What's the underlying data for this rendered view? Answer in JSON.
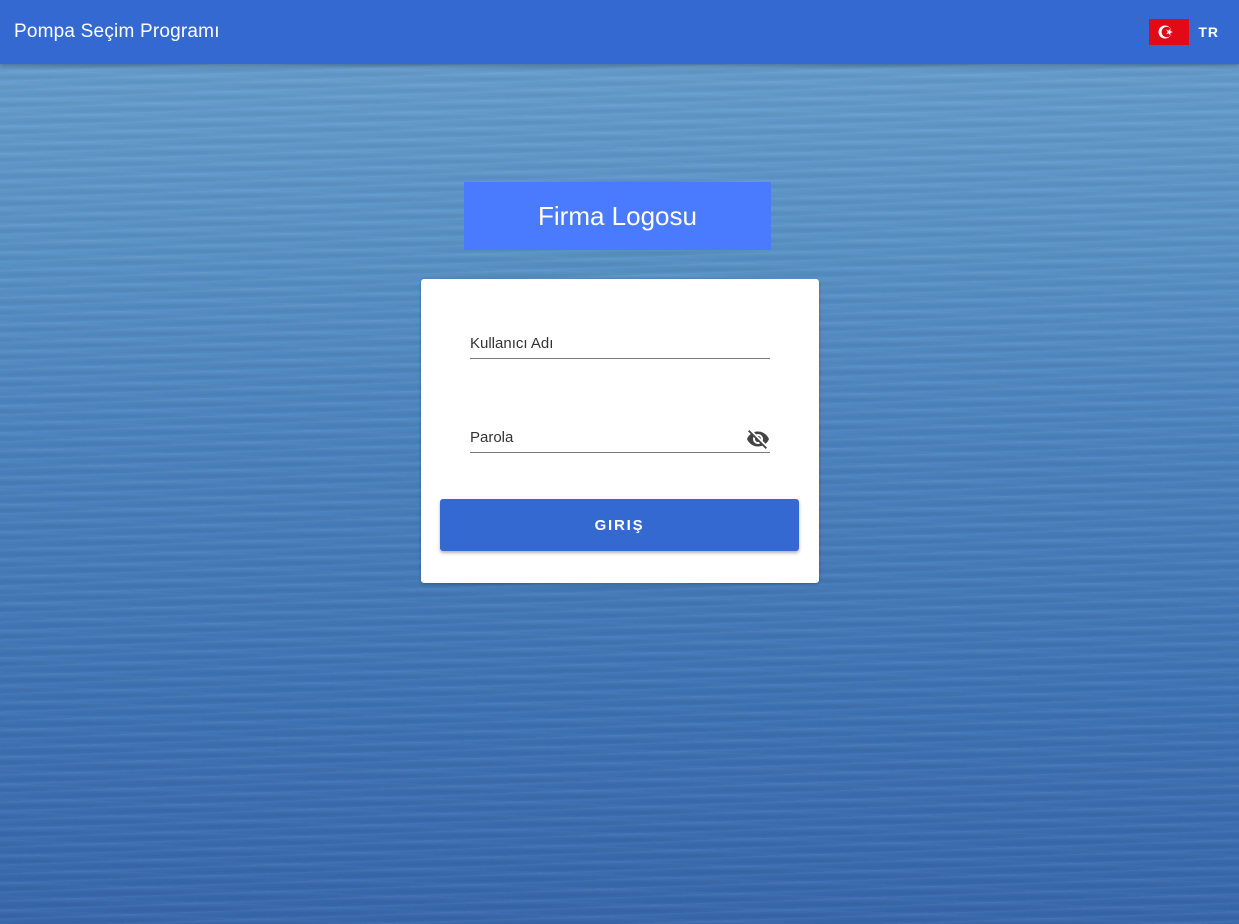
{
  "app_bar": {
    "title": "Pompa Seçim Programı",
    "language": {
      "flag_icon": "turkey-flag-icon",
      "code": "TR"
    },
    "color": "#3469d2"
  },
  "logo": {
    "text": "Firma Logosu",
    "color": "#4a7bff"
  },
  "login_form": {
    "username": {
      "placeholder": "Kullanıcı Adı",
      "value": ""
    },
    "password": {
      "placeholder": "Parola",
      "value": "",
      "toggle_icon": "eye-off-icon"
    },
    "submit_label": "GIRIŞ"
  }
}
